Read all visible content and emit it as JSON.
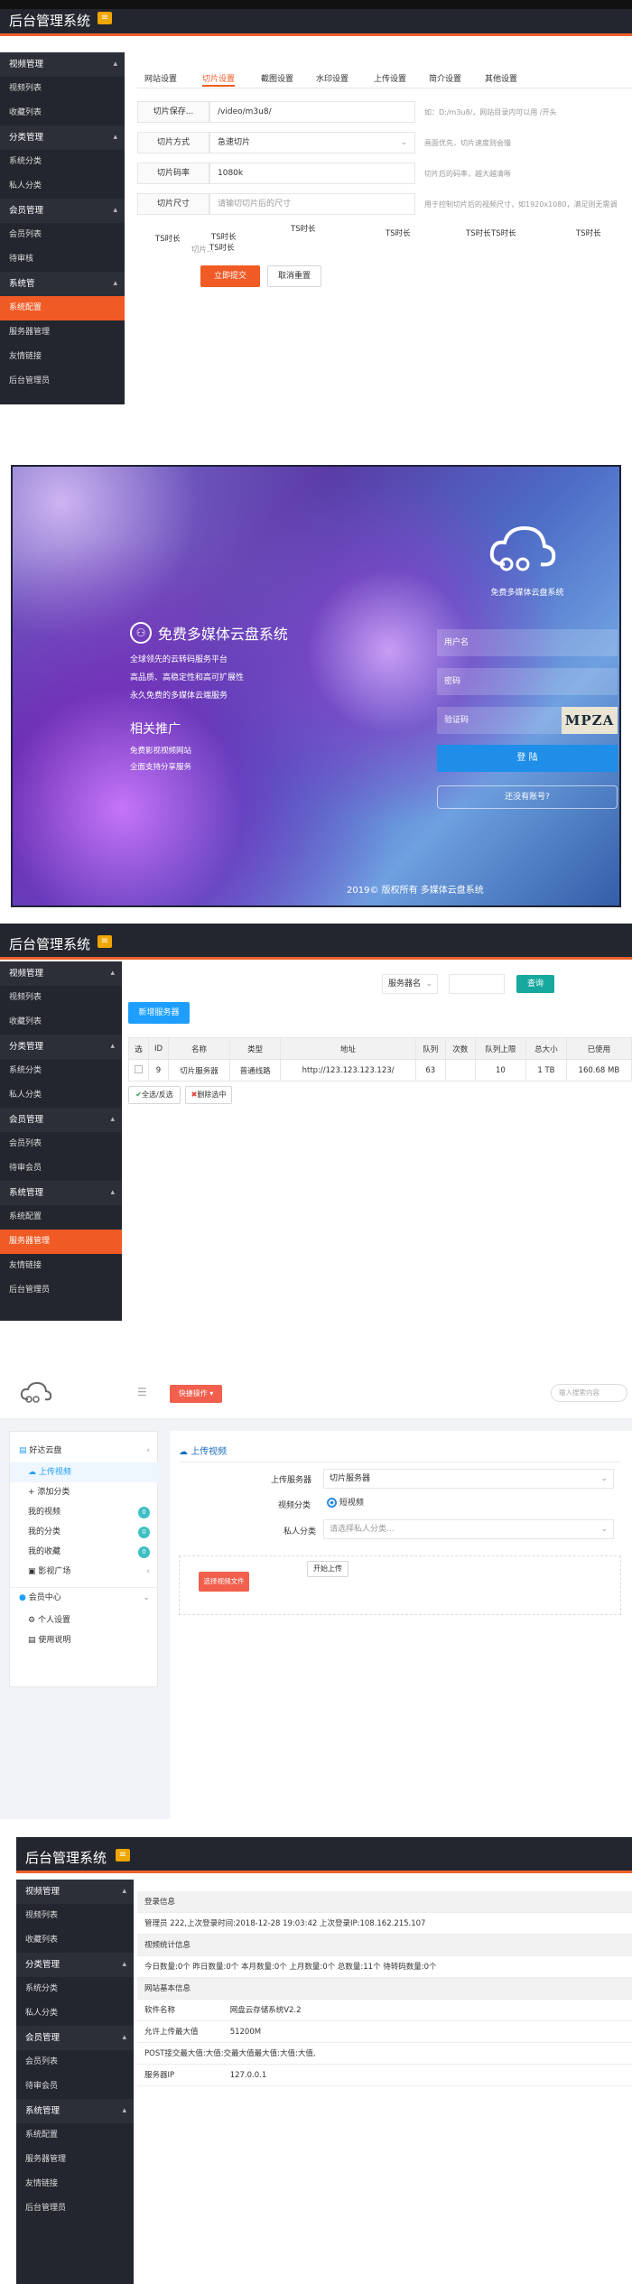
{
  "panel1": {
    "brand": "后台管理系统",
    "menu_icon": "menu-icon",
    "sidebar": [
      {
        "type": "group",
        "label": "视频管理"
      },
      {
        "type": "item",
        "label": "视频列表"
      },
      {
        "type": "item",
        "label": "收藏列表"
      },
      {
        "type": "group",
        "label": "分类管理"
      },
      {
        "type": "item",
        "label": "系统分类"
      },
      {
        "type": "item",
        "label": "私人分类"
      },
      {
        "type": "group",
        "label": "会员管理"
      },
      {
        "type": "item",
        "label": "会员列表"
      },
      {
        "type": "item",
        "label": "待审核"
      },
      {
        "type": "group",
        "label": "系统管"
      },
      {
        "type": "item",
        "label": "系统配置",
        "active": true
      },
      {
        "type": "item",
        "label": "服务器管理"
      },
      {
        "type": "item",
        "label": "友情链接"
      },
      {
        "type": "item",
        "label": "后台管理员"
      }
    ],
    "tabs": [
      "网站设置",
      "切片设置",
      "截图设置",
      "水印设置",
      "上传设置",
      "简介设置",
      "其他设置"
    ],
    "active_tab": "切片设置",
    "fields": [
      {
        "label": "切片保存...",
        "value": "/video/m3u8/",
        "hint": "如：D:/m3u8/，网站目录内可以用 /开头"
      },
      {
        "label": "切片方式",
        "value": "急速切片",
        "hint": "画面优先，切片速度则会慢"
      },
      {
        "label": "切片码率",
        "value": "1080k",
        "hint": "切片后的码率，越大越清晰"
      },
      {
        "label": "切片尺寸",
        "placeholder": "请输切切片后的尺寸",
        "hint": "用于控制切片后的视频尺寸，如1920x1080，满足则无需调"
      }
    ],
    "ts_labels": [
      "TS时长",
      "TS时长",
      "TS时长",
      "TS时长",
      "TS时长",
      "TS时长",
      "TS时长",
      "TS时长"
    ],
    "small_label": "切片...",
    "submit": "立即提交",
    "reset": "取消重置"
  },
  "panel2": {
    "slogan_title": "免费多媒体云盘系统",
    "slogan_lines": [
      "全球领先的云转码服务平台",
      "高品质、高稳定性和高可扩展性",
      "永久免费的多媒体云端服务"
    ],
    "promo_title": "相关推广",
    "promo_lines": [
      "免费影视视频网站",
      "全面支持分享服务"
    ],
    "card_title": "免费多媒体云盘系统",
    "username_ph": "用户名",
    "password_ph": "密码",
    "captcha_ph": "验证码",
    "captcha_text": "MPZA",
    "login_btn": "登 陆",
    "register_btn": "还没有账号?",
    "footer": "2019© 版权所有 多媒体云盘系统"
  },
  "panel3": {
    "brand": "后台管理系统",
    "sidebar": [
      {
        "type": "group",
        "label": "视频管理"
      },
      {
        "type": "item",
        "label": "视频列表"
      },
      {
        "type": "item",
        "label": "收藏列表"
      },
      {
        "type": "group",
        "label": "分类管理"
      },
      {
        "type": "item",
        "label": "系统分类"
      },
      {
        "type": "item",
        "label": "私人分类"
      },
      {
        "type": "group",
        "label": "会员管理"
      },
      {
        "type": "item",
        "label": "会员列表"
      },
      {
        "type": "item",
        "label": "待审会员"
      },
      {
        "type": "group",
        "label": "系统管理"
      },
      {
        "type": "item",
        "label": "系统配置"
      },
      {
        "type": "item",
        "label": "服务器管理",
        "active": true
      },
      {
        "type": "item",
        "label": "友情链接"
      },
      {
        "type": "item",
        "label": "后台管理员"
      }
    ],
    "search_select": "服务器名",
    "search_btn": "查询",
    "add_btn": "新增服务器",
    "columns": [
      "选",
      "ID",
      "名称",
      "类型",
      "地址",
      "队列",
      "次数",
      "队列上限",
      "总大小",
      "已使用"
    ],
    "rows": [
      [
        "",
        "9",
        "切片服务器",
        "普通线路",
        "http://123.123.123.123/",
        "63",
        "",
        "10",
        "1 TB",
        "160.68 MB"
      ]
    ],
    "select_all": "全选/反选",
    "delete_selected": "删除选中"
  },
  "panel4": {
    "dropdown_btn": "快捷操作",
    "search_ph": "输入搜索内容",
    "sidebar": {
      "section1": "好达云盘",
      "items": [
        {
          "label": "上传视频",
          "icon": "upload-icon",
          "active": true
        },
        {
          "label": "添加分类",
          "icon": "plus-icon"
        },
        {
          "label": "我的视频",
          "badge": "0"
        },
        {
          "label": "我的分类",
          "badge": "0"
        },
        {
          "label": "我的收藏",
          "badge": "0"
        },
        {
          "label": "影视广场",
          "icon": "folder-icon"
        }
      ],
      "section2": "会员中心",
      "items2": [
        {
          "label": "个人设置",
          "icon": "gear-icon"
        },
        {
          "label": "使用说明",
          "icon": "doc-icon"
        }
      ]
    },
    "title": "上传视频",
    "upload_server_label": "上传服务器",
    "upload_server_value": "切片服务器",
    "video_cat_label": "视频分类",
    "video_cat_value": "短视频",
    "private_cat_label": "私人分类",
    "private_cat_ph": "请选择私人分类...",
    "start_upload": "开始上传",
    "select_file": "选择视频文件"
  },
  "panel5": {
    "brand": "后台管理系统",
    "sidebar": [
      {
        "type": "group",
        "label": "视频管理"
      },
      {
        "type": "item",
        "label": "视频列表"
      },
      {
        "type": "item",
        "label": "收藏列表"
      },
      {
        "type": "group",
        "label": "分类管理"
      },
      {
        "type": "item",
        "label": "系统分类"
      },
      {
        "type": "item",
        "label": "私人分类"
      },
      {
        "type": "group",
        "label": "会员管理"
      },
      {
        "type": "item",
        "label": "会员列表"
      },
      {
        "type": "item",
        "label": "待审会员"
      },
      {
        "type": "group",
        "label": "系统管理"
      },
      {
        "type": "item",
        "label": "系统配置"
      },
      {
        "type": "item",
        "label": "服务器管理"
      },
      {
        "type": "item",
        "label": "友情链接"
      },
      {
        "type": "item",
        "label": "后台管理员"
      }
    ],
    "login_head": "登录信息",
    "login_info": "管理员 222,上次登录时间:2018-12-28 19:03:42 上次登录IP:108.162.215.107",
    "stats_head": "视频统计信息",
    "stats_info": "今日数量:0个 昨日数量:0个 本月数量:0个 上月数量:0个 总数量:11个 待转码数量:0个",
    "site_head": "网站基本信息",
    "site_rows": [
      [
        "软件名称",
        "网盘云存储系统V2.2"
      ],
      [
        "允许上传最大值",
        "51200M"
      ],
      [
        "POST接交最大值:大值:交最大值最大值:大值:大值,",
        ""
      ],
      [
        "服务器IP",
        "127.0.0.1"
      ]
    ]
  }
}
